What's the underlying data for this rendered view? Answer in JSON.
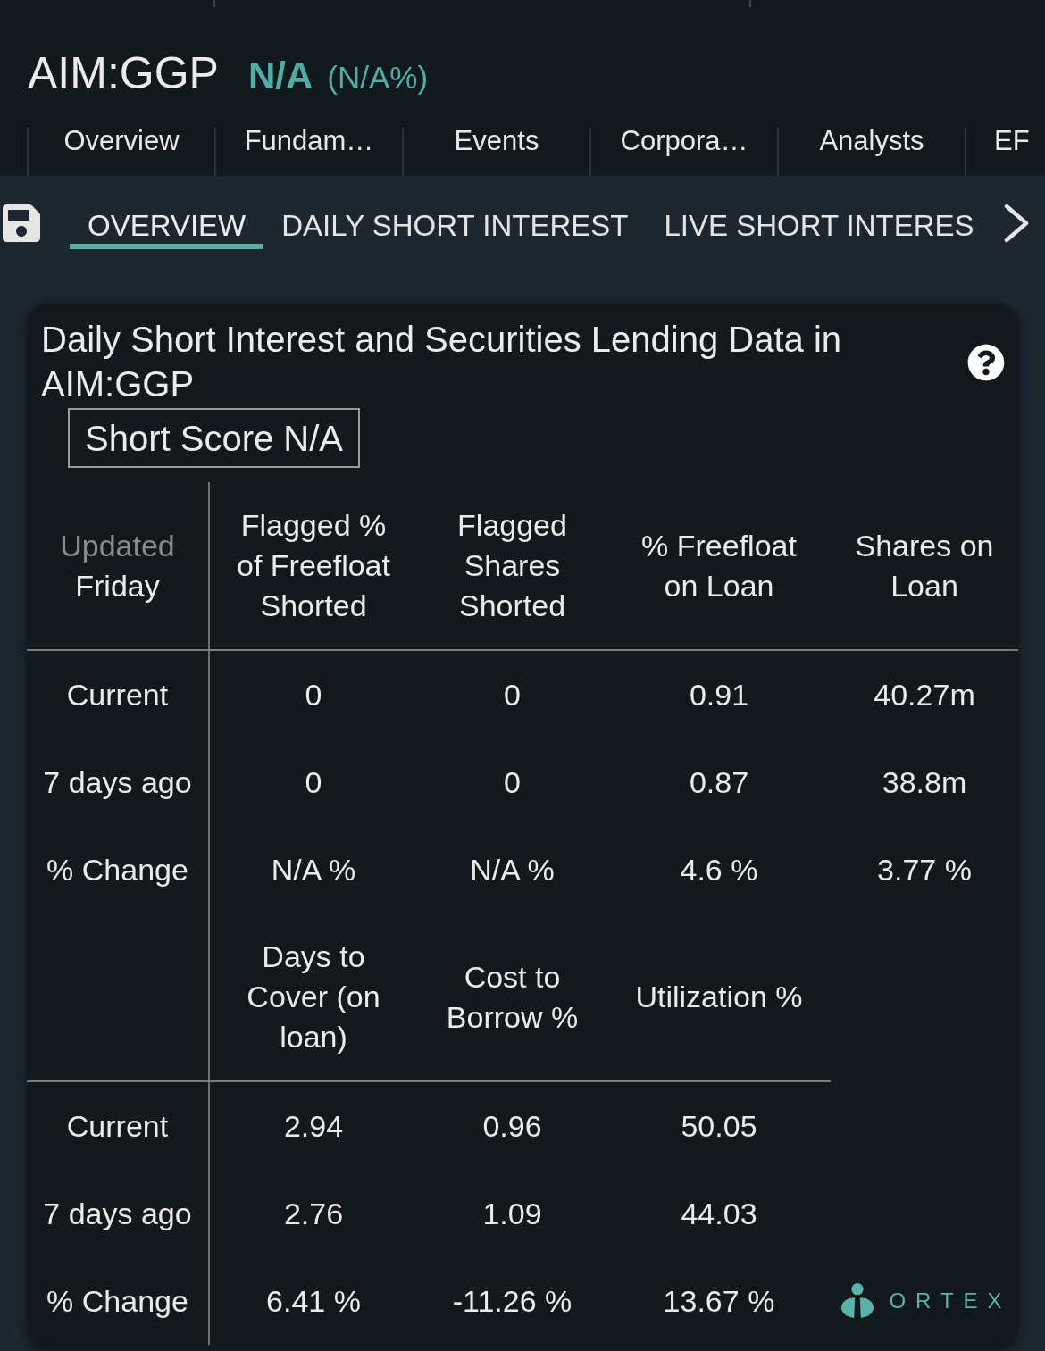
{
  "header": {
    "symbol": "AIM:GGP",
    "price": "N/A",
    "change": "(N/A%)"
  },
  "top_tabs": [
    {
      "label": "Overview",
      "selected": false
    },
    {
      "label": "Fundam…",
      "selected": false
    },
    {
      "label": "Events",
      "selected": false
    },
    {
      "label": "Corpora…",
      "selected": false
    },
    {
      "label": "Analysts",
      "selected": false
    },
    {
      "label": "EF",
      "selected": false
    }
  ],
  "sub_tabs": [
    {
      "label": "OVERVIEW",
      "selected": true
    },
    {
      "label": "DAILY SHORT INTEREST",
      "selected": false
    },
    {
      "label": "LIVE SHORT INTERES",
      "selected": false
    }
  ],
  "card": {
    "title": "Daily Short Interest and Securities Lending Data in AIM:GGP",
    "short_score": "Short Score N/A",
    "tables": [
      {
        "corner": {
          "label": "Updated",
          "value": "Friday"
        },
        "columns": [
          "Flagged % of Freefloat Shorted",
          "Flagged Shares Shorted",
          "% Freefloat on Loan",
          "Shares on Loan"
        ],
        "rows": [
          {
            "label": "Current",
            "values": [
              "0",
              "0",
              "0.91",
              "40.27m"
            ]
          },
          {
            "label": "7 days ago",
            "values": [
              "0",
              "0",
              "0.87",
              "38.8m"
            ]
          },
          {
            "label": "% Change",
            "values": [
              "N/A %",
              "N/A %",
              "4.6 %",
              "3.77 %"
            ]
          }
        ]
      },
      {
        "columns": [
          "Days to Cover (on loan)",
          "Cost to Borrow %",
          "Utilization %"
        ],
        "rows": [
          {
            "label": "Current",
            "values": [
              "2.94",
              "0.96",
              "50.05"
            ]
          },
          {
            "label": "7 days ago",
            "values": [
              "2.76",
              "1.09",
              "44.03"
            ]
          },
          {
            "label": "% Change",
            "values": [
              "6.41 %",
              "-11.26 %",
              "13.67 %"
            ]
          }
        ]
      }
    ],
    "logo": "ORTEX"
  }
}
